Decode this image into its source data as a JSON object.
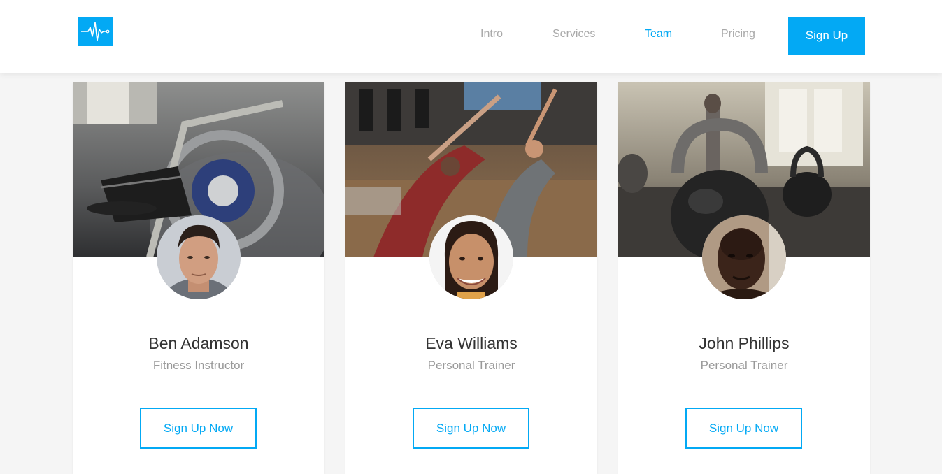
{
  "header": {
    "logo_icon": "heartbeat-icon",
    "nav": [
      {
        "label": "Intro",
        "active": false
      },
      {
        "label": "Services",
        "active": false
      },
      {
        "label": "Team",
        "active": true
      },
      {
        "label": "Pricing",
        "active": false
      }
    ],
    "signup_label": "Sign Up"
  },
  "colors": {
    "accent": "#03a9f4",
    "nav_inactive": "#a9a9a9",
    "name_text": "#333333",
    "role_text": "#9a9a9a",
    "background": "#f5f5f5"
  },
  "team": [
    {
      "name": "Ben Adamson",
      "role": "Fitness Instructor",
      "button": "Sign Up Now",
      "cover": "exercise-bike-photo",
      "avatar": "man-portrait-photo"
    },
    {
      "name": "Eva Williams",
      "role": "Personal Trainer",
      "button": "Sign Up Now",
      "cover": "stretching-class-photo",
      "avatar": "woman-portrait-photo"
    },
    {
      "name": "John Phillips",
      "role": "Personal Trainer",
      "button": "Sign Up Now",
      "cover": "kettlebell-gym-photo",
      "avatar": "man-portrait-photo"
    }
  ]
}
